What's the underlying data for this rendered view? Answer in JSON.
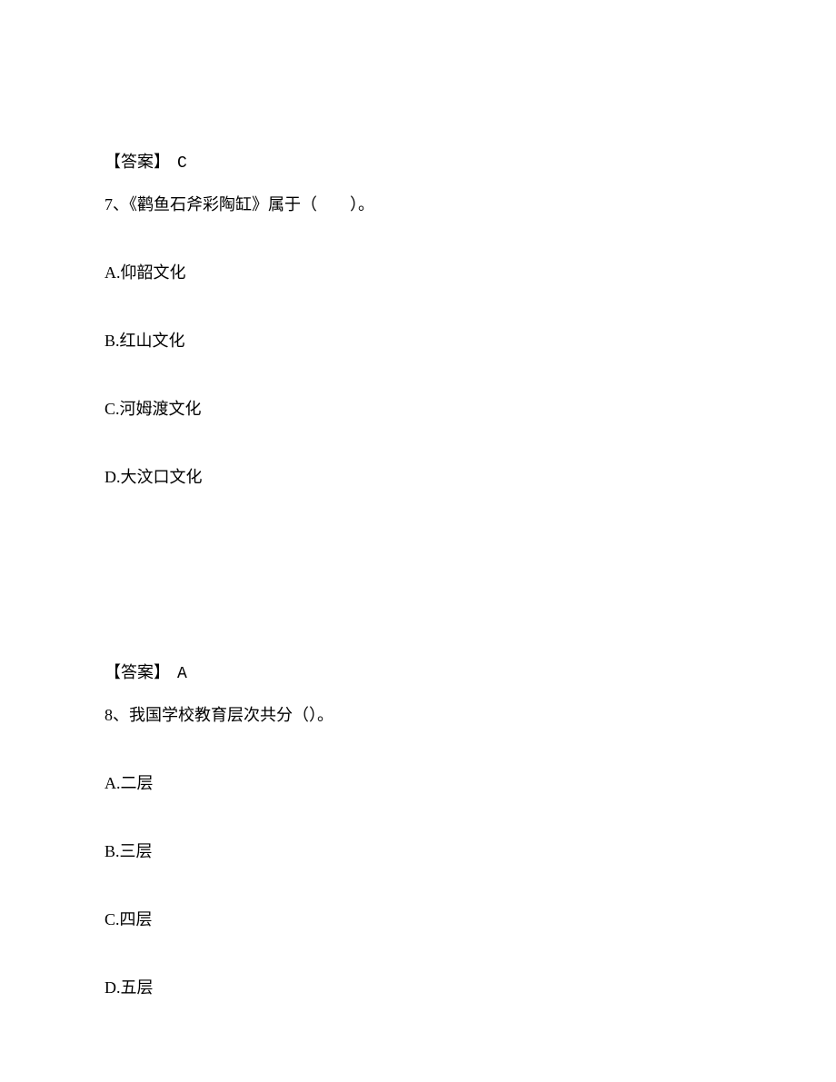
{
  "answer6": {
    "label": "【答案】",
    "value": "C"
  },
  "question7": {
    "number": "7、",
    "text": "《鹳鱼石斧彩陶缸》属于（　　）。",
    "options": {
      "a": "A.仰韶文化",
      "b": "B.红山文化",
      "c": "C.河姆渡文化",
      "d": "D.大汶口文化"
    }
  },
  "answer7": {
    "label": "【答案】",
    "value": "A"
  },
  "question8": {
    "number": "8、",
    "text": "我国学校教育层次共分（）。",
    "options": {
      "a": "A.二层",
      "b": "B.三层",
      "c": "C.四层",
      "d": "D.五层"
    }
  }
}
